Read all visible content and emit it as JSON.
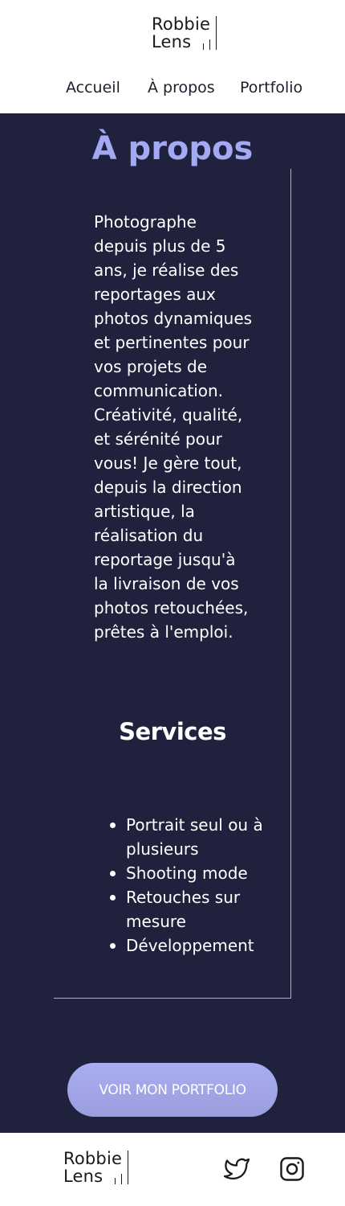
{
  "brand": {
    "line1": "Robbie",
    "line2": "Lens"
  },
  "nav": {
    "items": [
      {
        "label": "Accueil"
      },
      {
        "label": "À propos"
      },
      {
        "label": "Portfolio"
      }
    ]
  },
  "about": {
    "title": "À propos",
    "text": "Photographe depuis plus de 5 ans, je réalise des reportages aux photos dynamiques et pertinentes pour vos projets de communication. Créativité, qualité, et sérénité pour vous! Je gère tout, depuis la direction artistique, la réalisation du reportage jusqu'à la livraison de vos photos retouchées, prêtes à l'emploi."
  },
  "services": {
    "title": "Services",
    "items": [
      "Portrait seul ou à plusieurs",
      "Shooting mode",
      "Retouches sur mesure",
      "Développement"
    ]
  },
  "cta": {
    "label": "VOIR MON PORTFOLIO"
  },
  "footer": {
    "social": [
      {
        "icon": "twitter-icon"
      },
      {
        "icon": "instagram-icon"
      }
    ]
  },
  "colors": {
    "background": "#20223d",
    "accent": "#a4a9f3",
    "button": "#a2a6ea",
    "text": "#ffffff"
  }
}
